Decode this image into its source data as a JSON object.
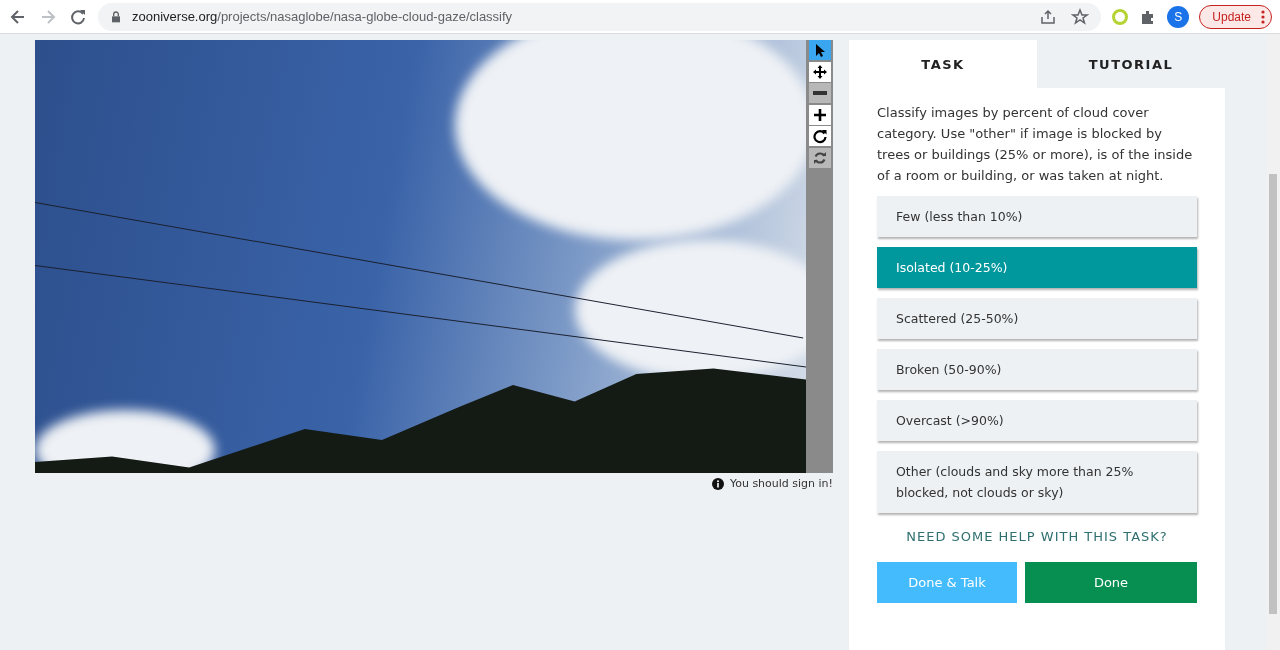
{
  "browser": {
    "url_host": "zooniverse.org",
    "url_path": "/projects/nasaglobe/nasa-globe-cloud-gaze/classify",
    "profile_initial": "S",
    "update_label": "Update"
  },
  "image_tools": [
    {
      "kind": "pointer",
      "selected": true,
      "disabled": false
    },
    {
      "kind": "move",
      "selected": false,
      "disabled": false
    },
    {
      "kind": "zoom-out",
      "selected": false,
      "disabled": true
    },
    {
      "kind": "zoom-in",
      "selected": false,
      "disabled": false
    },
    {
      "kind": "rotate",
      "selected": false,
      "disabled": false
    },
    {
      "kind": "reset",
      "selected": false,
      "disabled": true
    }
  ],
  "sign_in_notice": "You should sign in!",
  "tabs": [
    {
      "label": "TASK",
      "selected": true
    },
    {
      "label": "TUTORIAL",
      "selected": false
    }
  ],
  "task": {
    "instruction": "Classify images by percent of cloud cover category. Use \"other\" if image is blocked by trees or buildings (25% or more), is of the inside of a room or building, or was taken at night.",
    "answers": [
      {
        "label": "Few (less than 10%)",
        "selected": false
      },
      {
        "label": "Isolated (10-25%)",
        "selected": true
      },
      {
        "label": "Scattered (25-50%)",
        "selected": false
      },
      {
        "label": "Broken (50-90%)",
        "selected": false
      },
      {
        "label": "Overcast (>90%)",
        "selected": false
      },
      {
        "label": "Other (clouds and sky more than 25% blocked, not clouds or sky)",
        "selected": false
      }
    ],
    "help_link": "NEED SOME HELP WITH THIS TASK?",
    "buttons": [
      {
        "kind": "talk",
        "label": "Done & Talk"
      },
      {
        "kind": "done",
        "label": "Done"
      }
    ]
  }
}
